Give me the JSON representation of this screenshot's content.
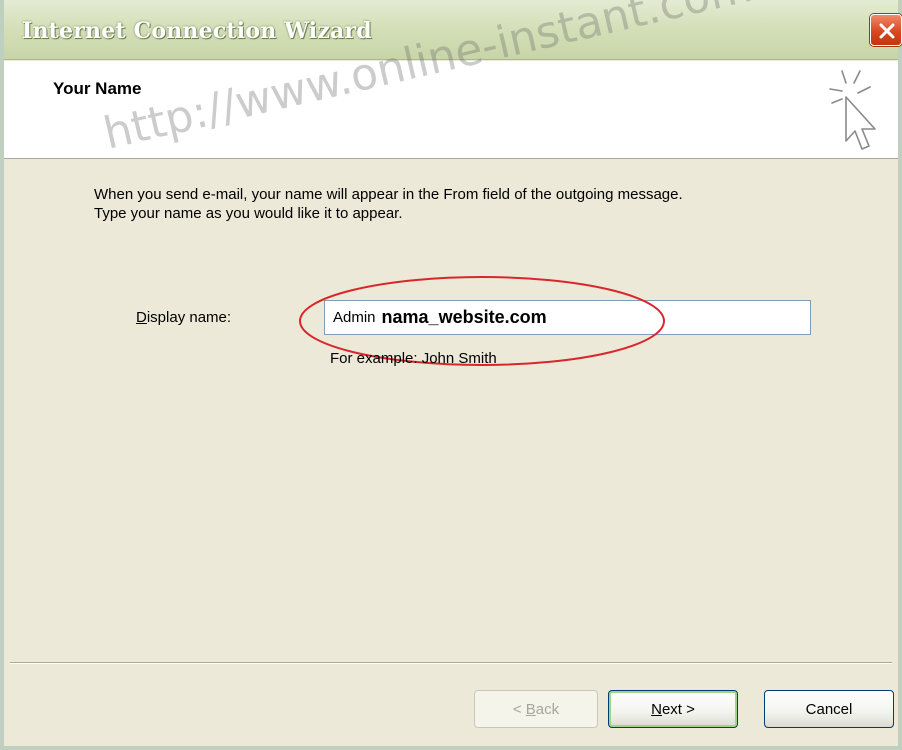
{
  "window": {
    "title": "Internet Connection Wizard",
    "close_icon": "close-icon"
  },
  "header": {
    "title": "Your Name",
    "icon": "wizard-cursor-icon"
  },
  "watermark": "http://www.online-instant.com",
  "intro": {
    "line1": "When you send e-mail, your name will appear in the From field of the outgoing message.",
    "line2": "Type your name as you would like it to appear."
  },
  "display_name": {
    "label_mnemonic": "D",
    "label_rest": "isplay name:",
    "value_prefix": "Admin",
    "value_bold": "nama_website.com",
    "example": "For example: John Smith"
  },
  "buttons": {
    "back_prefix": "< ",
    "back_mnemonic": "B",
    "back_rest": "ack",
    "back_enabled": false,
    "next_mnemonic": "N",
    "next_rest": "ext >",
    "cancel": "Cancel"
  },
  "colors": {
    "highlight_ellipse": "#d9262b",
    "title_bar": "#d5e0b9",
    "close_button": "#d9481f"
  }
}
